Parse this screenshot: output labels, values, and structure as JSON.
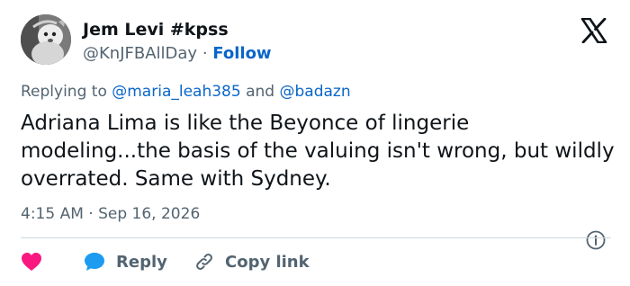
{
  "author": {
    "display_name": "Jem Levi #kpss",
    "handle": "@KnJFBAllDay",
    "separator": "·",
    "follow_label": "Follow"
  },
  "logo": {
    "icon": "x-logo-icon"
  },
  "reply_context": {
    "prefix": "Replying to",
    "mention_1": "@maria_leah385",
    "conjunction": "and",
    "mention_2": "@badazn"
  },
  "tweet": {
    "text": "Adriana Lima is like the Beyonce of lingerie modeling...the basis of the valuing isn't wrong, but wildly overrated. Same with Sydney.",
    "time": "4:15 AM",
    "separator": "·",
    "date": "Sep 16, 2026"
  },
  "actions": {
    "like_icon": "heart-icon",
    "reply_icon": "chat-bubble-icon",
    "reply_label": "Reply",
    "copy_icon": "link-icon",
    "copy_label": "Copy link"
  },
  "colors": {
    "accent": "#0a66c8",
    "like": "#f91880",
    "reply_icon": "#1d9bf0",
    "muted_text": "#536471",
    "divider": "#cfd9de"
  }
}
